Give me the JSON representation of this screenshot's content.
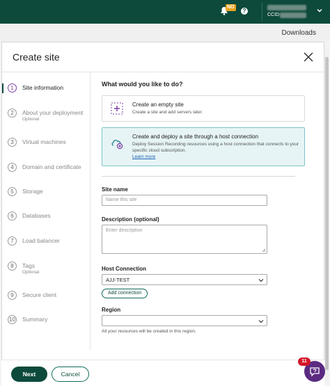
{
  "topbar": {
    "bell_badge": "NO",
    "help_glyph": "?",
    "ccid_label": "CCID:"
  },
  "downloads": "Downloads",
  "modal": {
    "title": "Create site"
  },
  "steps": [
    {
      "num": "1",
      "label": "Site information",
      "sub": ""
    },
    {
      "num": "2",
      "label": "About your deployment",
      "sub": "Optional"
    },
    {
      "num": "3",
      "label": "Virtual machines",
      "sub": ""
    },
    {
      "num": "4",
      "label": "Domain and certificate",
      "sub": ""
    },
    {
      "num": "5",
      "label": "Storage",
      "sub": ""
    },
    {
      "num": "6",
      "label": "Databases",
      "sub": ""
    },
    {
      "num": "7",
      "label": "Load balancer",
      "sub": ""
    },
    {
      "num": "8",
      "label": "Tags",
      "sub": "Optional"
    },
    {
      "num": "9",
      "label": "Secure client",
      "sub": ""
    },
    {
      "num": "10",
      "label": "Summary",
      "sub": ""
    }
  ],
  "content": {
    "question": "What would you like to do?",
    "option1": {
      "title": "Create an empty site",
      "desc": "Create a site and add servers later."
    },
    "option2": {
      "title": "Create and deploy a site through a host connection",
      "desc": "Deploy Session Recording resources using a host connection that connects to your specific cloud subscription.",
      "link": "Learn more"
    },
    "site_name": {
      "label": "Site name",
      "placeholder": "Name this site"
    },
    "description": {
      "label": "Description (optional)",
      "placeholder": "Enter description"
    },
    "host_connection": {
      "label": "Host Connection",
      "value": "AJJ-TEST",
      "add_button": "Add connection"
    },
    "region": {
      "label": "Region",
      "value": "",
      "hint": "All your resources will be created in this region."
    }
  },
  "footer": {
    "next": "Next",
    "cancel": "Cancel"
  },
  "help_bubble": {
    "badge": "11"
  },
  "colors": {
    "brand": "#0d4a3c",
    "accent_purple": "#7b3fa0",
    "selected_card": "#e6f4f5",
    "badge_red": "#d4182a"
  }
}
